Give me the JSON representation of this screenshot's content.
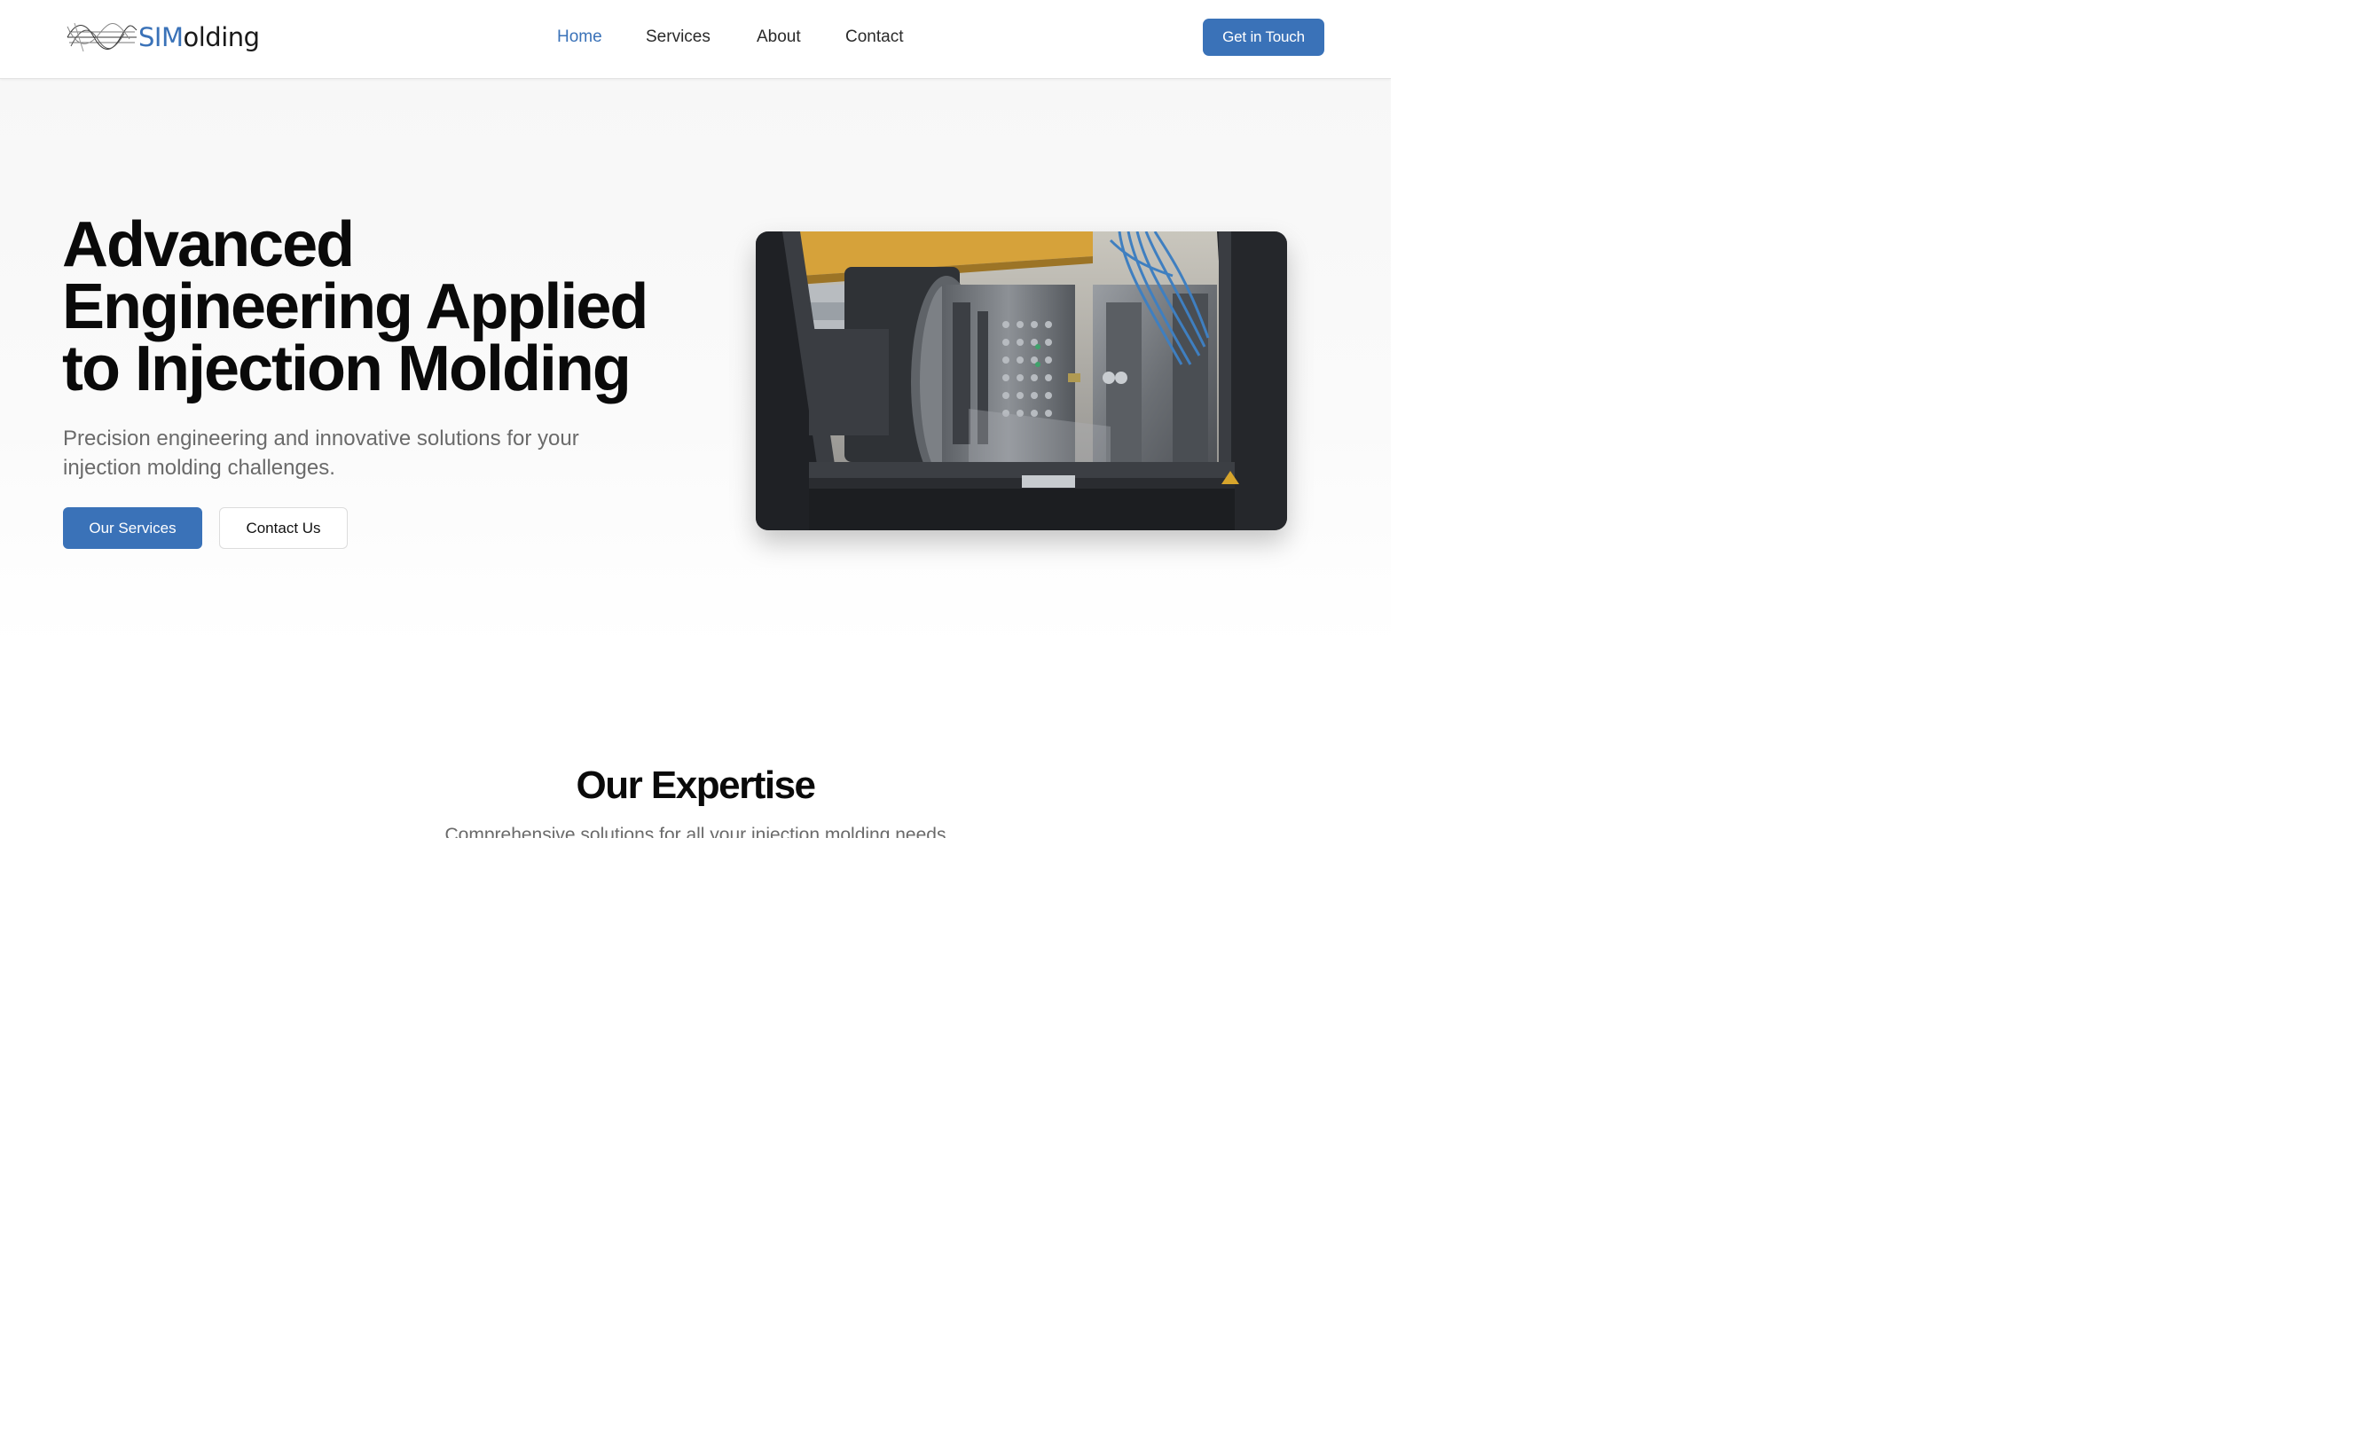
{
  "header": {
    "logo": {
      "text_primary": "SIM",
      "text_secondary": "olding"
    },
    "nav": [
      {
        "label": "Home",
        "active": true
      },
      {
        "label": "Services",
        "active": false
      },
      {
        "label": "About",
        "active": false
      },
      {
        "label": "Contact",
        "active": false
      }
    ],
    "cta_label": "Get in Touch"
  },
  "hero": {
    "title": "Advanced Engineering Applied to Injection Molding",
    "subtitle": "Precision engineering and innovative solutions for your injection molding challenges.",
    "primary_button": "Our Services",
    "secondary_button": "Contact Us"
  },
  "expertise": {
    "title": "Our Expertise",
    "subtitle": "Comprehensive solutions for all your injection molding needs"
  },
  "colors": {
    "brand_blue": "#3a72b8",
    "text_dark": "#0a0a0a",
    "text_muted": "#6a6a6a",
    "hero_bg": "#f7f7f7"
  },
  "icons": [
    "logo-wave-icon"
  ]
}
